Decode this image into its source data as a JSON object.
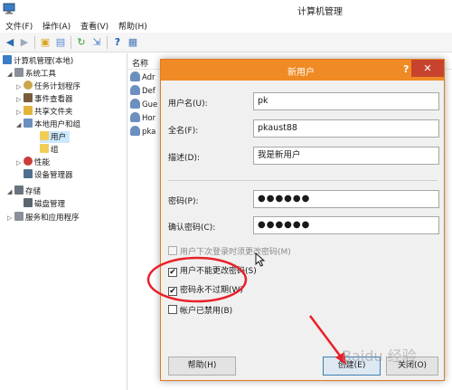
{
  "window": {
    "title": "计算机管理"
  },
  "menu": [
    "文件(F)",
    "操作(A)",
    "查看(V)",
    "帮助(H)"
  ],
  "toolbar_icons": [
    "back-icon",
    "forward-icon",
    "folder-up-icon",
    "show-hide-tree-icon",
    "refresh-icon",
    "export-icon",
    "help-icon",
    "properties-icon"
  ],
  "tree": [
    {
      "label": "计算机管理(本地)",
      "icon": "computer-management-icon"
    },
    {
      "label": "系统工具",
      "icon": "tools-icon"
    },
    {
      "label": "任务计划程序",
      "icon": "clock-icon"
    },
    {
      "label": "事件查看器",
      "icon": "event-viewer-icon"
    },
    {
      "label": "共享文件夹",
      "icon": "shared-folder-icon"
    },
    {
      "label": "本地用户和组",
      "icon": "users-group-icon"
    },
    {
      "label": "用户",
      "icon": "folder-icon"
    },
    {
      "label": "组",
      "icon": "folder-icon"
    },
    {
      "label": "性能",
      "icon": "performance-icon"
    },
    {
      "label": "设备管理器",
      "icon": "device-manager-icon"
    },
    {
      "label": "存储",
      "icon": "storage-icon"
    },
    {
      "label": "磁盘管理",
      "icon": "disk-icon"
    },
    {
      "label": "服务和应用程序",
      "icon": "services-icon"
    }
  ],
  "list": {
    "header": "名称",
    "rows": [
      "Adr",
      "Def",
      "Gue",
      "Hor",
      "pka"
    ]
  },
  "dialog": {
    "title": "新用户",
    "help": "?",
    "close": "✕",
    "username_label": "用户名(U):",
    "username_value": "pk",
    "fullname_label": "全名(F):",
    "fullname_value": "pkaust88",
    "desc_label": "描述(D):",
    "desc_value": "我是新用户",
    "password_label": "密码(P):",
    "password_value": "●●●●●●",
    "confirm_label": "确认密码(C):",
    "confirm_value": "●●●●●●",
    "chk_must_change": "用户下次登录时须更改密码(M)",
    "chk_cannot_change": "用户不能更改密码(S)",
    "chk_never_expires": "密码永不过期(W)",
    "chk_disabled": "帐户已禁用(B)",
    "btn_help": "帮助(H)",
    "btn_create": "创建(E)",
    "btn_close": "关闭(O)"
  },
  "colors": {
    "dialog_title": "#f08a24",
    "close_button": "#c7432d",
    "annotation": "#e8202a"
  }
}
